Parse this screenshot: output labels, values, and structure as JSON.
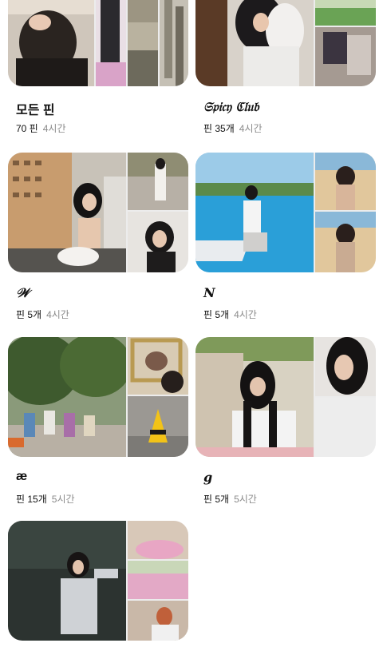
{
  "boards": [
    {
      "title": "모든 핀",
      "pin_count": "70 핀",
      "updated": "4시간"
    },
    {
      "title": "𝔖𝔭𝔦𝔠𝔶 ℭ𝔩𝔲𝔟",
      "pin_count": "핀 35개",
      "updated": "4시간"
    },
    {
      "title": "𝒲",
      "pin_count": "핀 5개",
      "updated": "4시간"
    },
    {
      "title": "𝑵",
      "pin_count": "핀 5개",
      "updated": "4시간"
    },
    {
      "title": "æ",
      "pin_count": "핀 15개",
      "updated": "5시간"
    },
    {
      "title": "𝒈",
      "pin_count": "핀 5개",
      "updated": "5시간"
    },
    {
      "title": "",
      "pin_count": "",
      "updated": ""
    }
  ]
}
